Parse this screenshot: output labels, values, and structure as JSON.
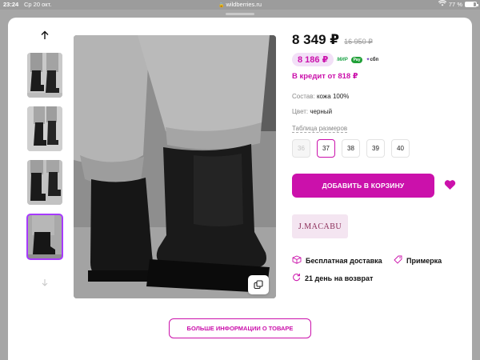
{
  "status_bar": {
    "time": "23:24",
    "date": "Ср 20 окт.",
    "url": "wildberries.ru",
    "battery": "77 %",
    "lock_icon": "lock-icon",
    "wifi_icon": "wifi-icon"
  },
  "gallery": {
    "up_icon": "arrow-up-icon",
    "down_icon": "arrow-down-icon",
    "thumbnails": [
      {
        "name": "thumbnail-1",
        "active": false
      },
      {
        "name": "thumbnail-2",
        "active": false
      },
      {
        "name": "thumbnail-3",
        "active": false
      },
      {
        "name": "thumbnail-4",
        "active": true
      }
    ],
    "copy_icon": "copy-icon"
  },
  "product": {
    "price": "8 349 ₽",
    "old_price": "16 950 ₽",
    "wallet_price": "8 186 ₽",
    "payment_badges": {
      "mir": "МИР",
      "sberpay": "Pay",
      "sbp": "сбп"
    },
    "credit": "В кредит от 818 ₽",
    "composition_label": "Состав:",
    "composition_value": "кожа 100%",
    "color_label": "Цвет:",
    "color_value": "черный",
    "size_table_link": "Таблица размеров",
    "sizes": [
      {
        "label": "36",
        "state": "disabled"
      },
      {
        "label": "37",
        "state": "selected"
      },
      {
        "label": "38",
        "state": "normal"
      },
      {
        "label": "39",
        "state": "normal"
      },
      {
        "label": "40",
        "state": "normal"
      }
    ],
    "add_to_cart": "ДОБАВИТЬ В КОРЗИНУ",
    "favorite_icon": "heart-icon",
    "brand": "J.MACABU"
  },
  "features": {
    "delivery": "Бесплатная доставка",
    "fitting": "Примерка",
    "returns": "21 день на возврат"
  },
  "more_button": "БОЛЬШЕ ИНФОРМАЦИИ О ТОВАРЕ",
  "colors": {
    "accent": "#cb11ab",
    "wallet_bg": "#f2e0f7",
    "thumb_active": "#a73afd"
  }
}
